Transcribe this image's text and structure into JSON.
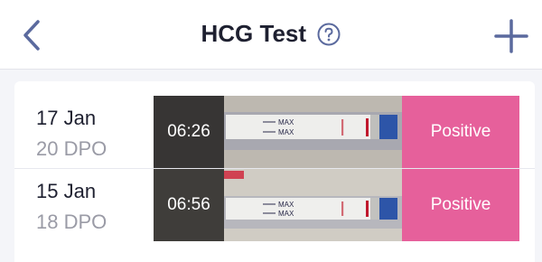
{
  "header": {
    "title": "HCG Test",
    "back_icon": "chevron-left-icon",
    "help_icon": "question-circle-icon",
    "add_icon": "plus-icon"
  },
  "tests": [
    {
      "date": "17 Jan",
      "dpo": "20 DPO",
      "time": "06:26",
      "result": "Positive",
      "strip_marks": [
        "MAX",
        "MAX"
      ]
    },
    {
      "date": "15 Jan",
      "dpo": "18 DPO",
      "time": "06:56",
      "result": "Positive",
      "strip_marks": [
        "MAX",
        "MAX"
      ]
    }
  ],
  "colors": {
    "positive": "#e6609b",
    "accent": "#5b6a9e",
    "title": "#1e2030",
    "muted": "#9a9ba6"
  }
}
